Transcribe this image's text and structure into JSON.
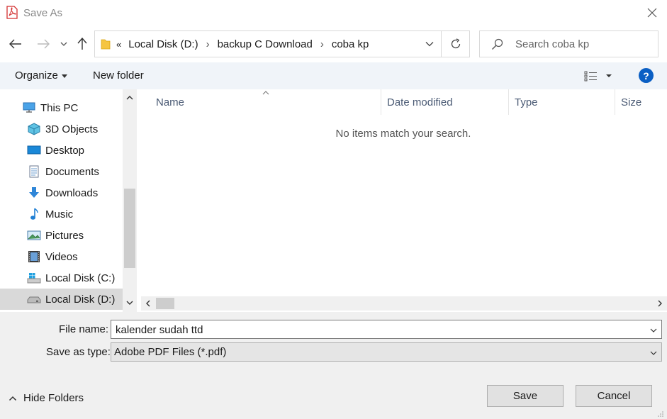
{
  "window": {
    "title": "Save As",
    "accent_color": "#0b5fc4",
    "selected_nav_color": "#cce8ff"
  },
  "address_bar": {
    "overflow_chevron": "«",
    "crumbs": [
      "Local Disk (D:)",
      "backup C Download",
      "coba kp"
    ]
  },
  "search": {
    "placeholder": "Search coba kp"
  },
  "toolbar": {
    "organize_label": "Organize",
    "new_folder_label": "New folder",
    "help_label": "?"
  },
  "sidebar": {
    "items": [
      {
        "label": "This PC",
        "icon": "pc-icon"
      },
      {
        "label": "3D Objects",
        "icon": "cube-icon"
      },
      {
        "label": "Desktop",
        "icon": "desktop-icon"
      },
      {
        "label": "Documents",
        "icon": "documents-icon"
      },
      {
        "label": "Downloads",
        "icon": "download-arrow-icon"
      },
      {
        "label": "Music",
        "icon": "music-note-icon"
      },
      {
        "label": "Pictures",
        "icon": "pictures-icon"
      },
      {
        "label": "Videos",
        "icon": "film-icon"
      },
      {
        "label": "Local Disk (C:)",
        "icon": "windows-drive-icon"
      },
      {
        "label": "Local Disk (D:)",
        "icon": "drive-icon"
      }
    ]
  },
  "file_list": {
    "columns": [
      "Name",
      "Date modified",
      "Type",
      "Size"
    ],
    "empty_message": "No items match your search."
  },
  "form": {
    "file_name_label": "File name:",
    "file_name_value": "kalender sudah ttd",
    "save_type_label": "Save as type:",
    "save_type_value": "Adobe PDF Files (*.pdf)"
  },
  "footer": {
    "hide_folders_label": "Hide Folders",
    "save_label": "Save",
    "cancel_label": "Cancel"
  }
}
